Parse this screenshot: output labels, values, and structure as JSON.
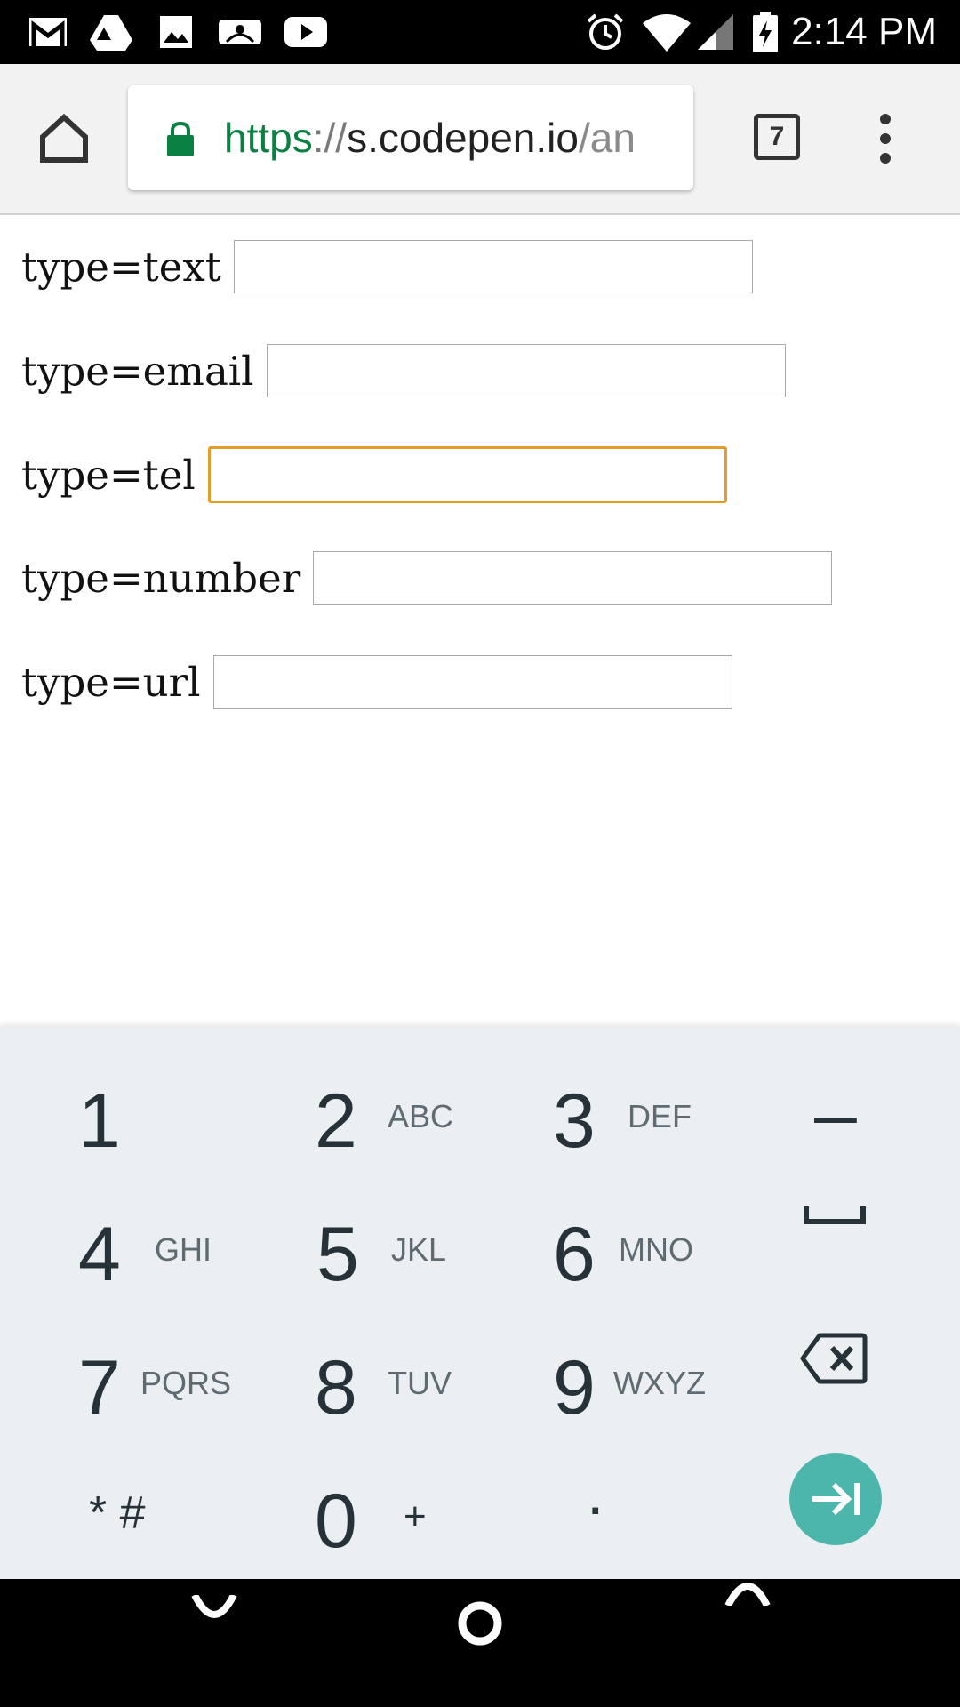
{
  "status_bar": {
    "time": "2:14 PM",
    "icons": [
      "gmail-icon",
      "drive-icon",
      "gallery-icon",
      "mlb-icon",
      "youtube-icon",
      "alarm-icon",
      "wifi-icon",
      "signal-icon",
      "battery-charging-icon"
    ]
  },
  "browser": {
    "url_scheme": "https",
    "url_sep": "://",
    "url_host": "s.codepen.io",
    "url_path": "/an",
    "tab_count": "7",
    "secure_color": "#0b8043"
  },
  "form": {
    "fields": [
      {
        "label": "type=text",
        "value": ""
      },
      {
        "label": "type=email",
        "value": ""
      },
      {
        "label": "type=tel",
        "value": ""
      },
      {
        "label": "type=number",
        "value": ""
      },
      {
        "label": "type=url",
        "value": ""
      }
    ],
    "focus_color": "#e59d2a"
  },
  "keypad": {
    "keys": [
      {
        "digit": "1",
        "letters": ""
      },
      {
        "digit": "2",
        "letters": "ABC"
      },
      {
        "digit": "3",
        "letters": "DEF"
      },
      {
        "digit": "4",
        "letters": "GHI"
      },
      {
        "digit": "5",
        "letters": "JKL"
      },
      {
        "digit": "6",
        "letters": "MNO"
      },
      {
        "digit": "7",
        "letters": "PQRS"
      },
      {
        "digit": "8",
        "letters": "TUV"
      },
      {
        "digit": "9",
        "letters": "WXYZ"
      },
      {
        "digit": "* #",
        "letters": ""
      },
      {
        "digit": "0",
        "letters": "+"
      },
      {
        "digit": ".",
        "letters": ""
      }
    ],
    "dash": "–",
    "action_color": "#4db6ac"
  }
}
